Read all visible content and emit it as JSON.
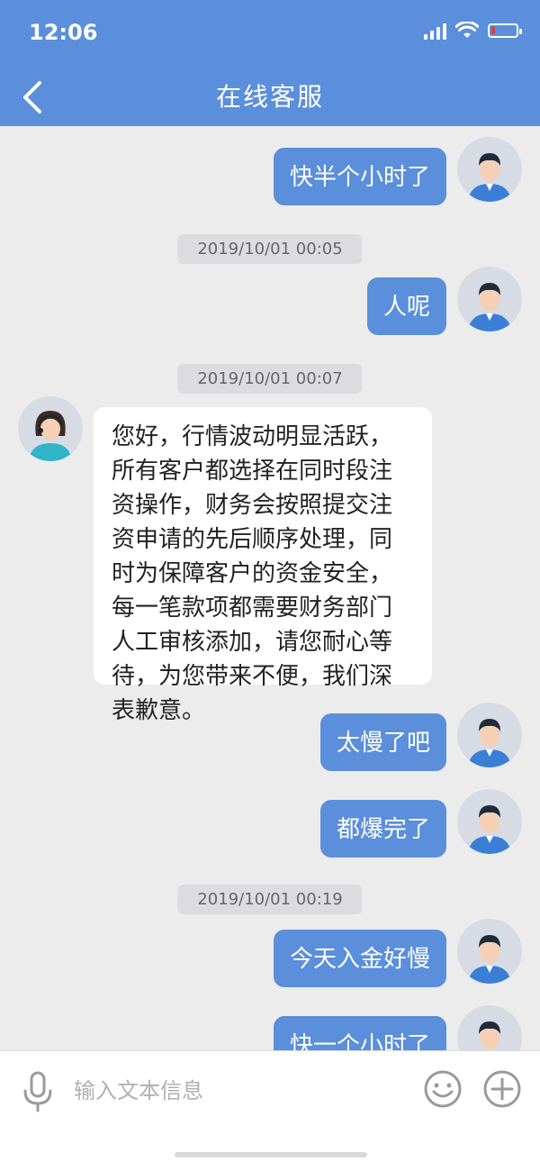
{
  "status_bar": {
    "time": "12:06"
  },
  "header": {
    "title": "在线客服",
    "back_icon": "back-chevron-icon"
  },
  "colors": {
    "primary": "#5b8fdb",
    "background": "#ececed",
    "agent_bubble": "#ffffff",
    "timestamp_bg": "#dcdcde",
    "battery_low": "#e23b3b"
  },
  "messages": [
    {
      "side": "out",
      "text": "快半个小时了"
    },
    {
      "side": "ts",
      "text": "2019/10/01 00:05"
    },
    {
      "side": "out",
      "text": "人呢"
    },
    {
      "side": "ts",
      "text": "2019/10/01 00:07"
    },
    {
      "side": "in",
      "text": "您好，行情波动明显活跃，所有客户都选择在同时段注资操作，财务会按照提交注资申请的先后顺序处理，同时为保障客户的资金安全，每一笔款项都需要财务部门人工审核添加，请您耐心等待，为您带来不便，我们深表歉意。"
    },
    {
      "side": "out",
      "text": "太慢了吧"
    },
    {
      "side": "out",
      "text": "都爆完了"
    },
    {
      "side": "ts",
      "text": "2019/10/01 00:19"
    },
    {
      "side": "out",
      "text": "今天入金好慢"
    },
    {
      "side": "out",
      "text": "快一个小时了"
    }
  ],
  "input_bar": {
    "placeholder": "输入文本信息",
    "mic_icon": "microphone-icon",
    "emoji_icon": "smiley-icon",
    "plus_icon": "plus-circle-icon"
  }
}
